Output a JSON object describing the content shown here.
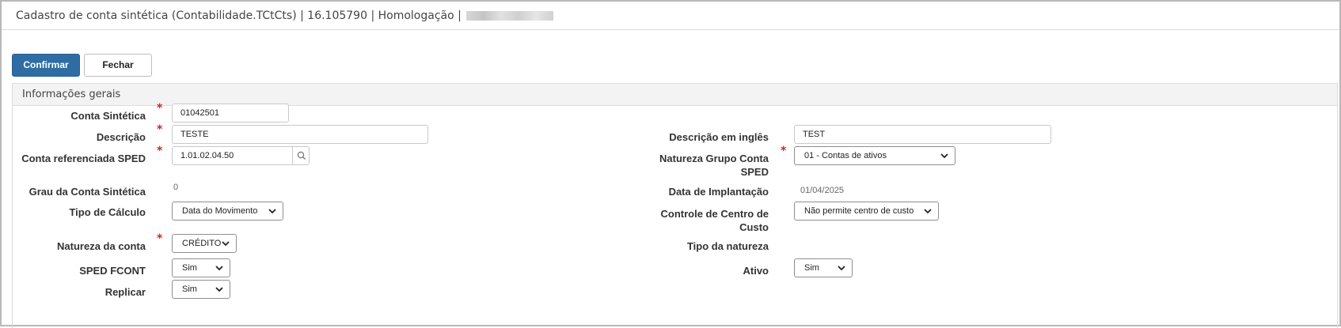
{
  "window": {
    "title": "Cadastro de conta sintética (Contabilidade.TCtCts) | 16.105790 | Homologação |"
  },
  "toolbar": {
    "confirm_label": "Confirmar",
    "close_label": "Fechar"
  },
  "section": {
    "title": "Informações gerais"
  },
  "form": {
    "conta_sintetica": {
      "label": "Conta Sintética",
      "value": "01042501"
    },
    "descricao": {
      "label": "Descrição",
      "value": "TESTE"
    },
    "descricao_ingles": {
      "label": "Descrição em inglês",
      "value": "TEST"
    },
    "conta_referenciada": {
      "label": "Conta referenciada SPED",
      "value": "1.01.02.04.50",
      "lookup_icon": "search-icon"
    },
    "natureza_grupo": {
      "label_line1": "Natureza Grupo Conta",
      "label_line2": "SPED",
      "value": "01 - Contas de ativos"
    },
    "grau": {
      "label": "Grau da Conta Sintética",
      "value": "0"
    },
    "data_implantacao": {
      "label": "Data de Implantação",
      "value": "01/04/2025"
    },
    "tipo_calculo": {
      "label": "Tipo de Cálculo",
      "value": "Data do Movimento"
    },
    "controle_centro": {
      "label_line1": "Controle de Centro de",
      "label_line2": "Custo",
      "value": "Não permite centro de custo"
    },
    "natureza_conta": {
      "label": "Natureza da conta",
      "value": "CRÉDITO"
    },
    "tipo_natureza": {
      "label": "Tipo da natureza"
    },
    "sped_fcont": {
      "label": "SPED FCONT",
      "value": "Sim"
    },
    "ativo": {
      "label": "Ativo",
      "value": "Sim"
    },
    "replicar": {
      "label": "Replicar",
      "value": "Sim"
    }
  },
  "required_mark": "*",
  "colors": {
    "primary": "#2e6da4",
    "required": "#d9201a"
  }
}
